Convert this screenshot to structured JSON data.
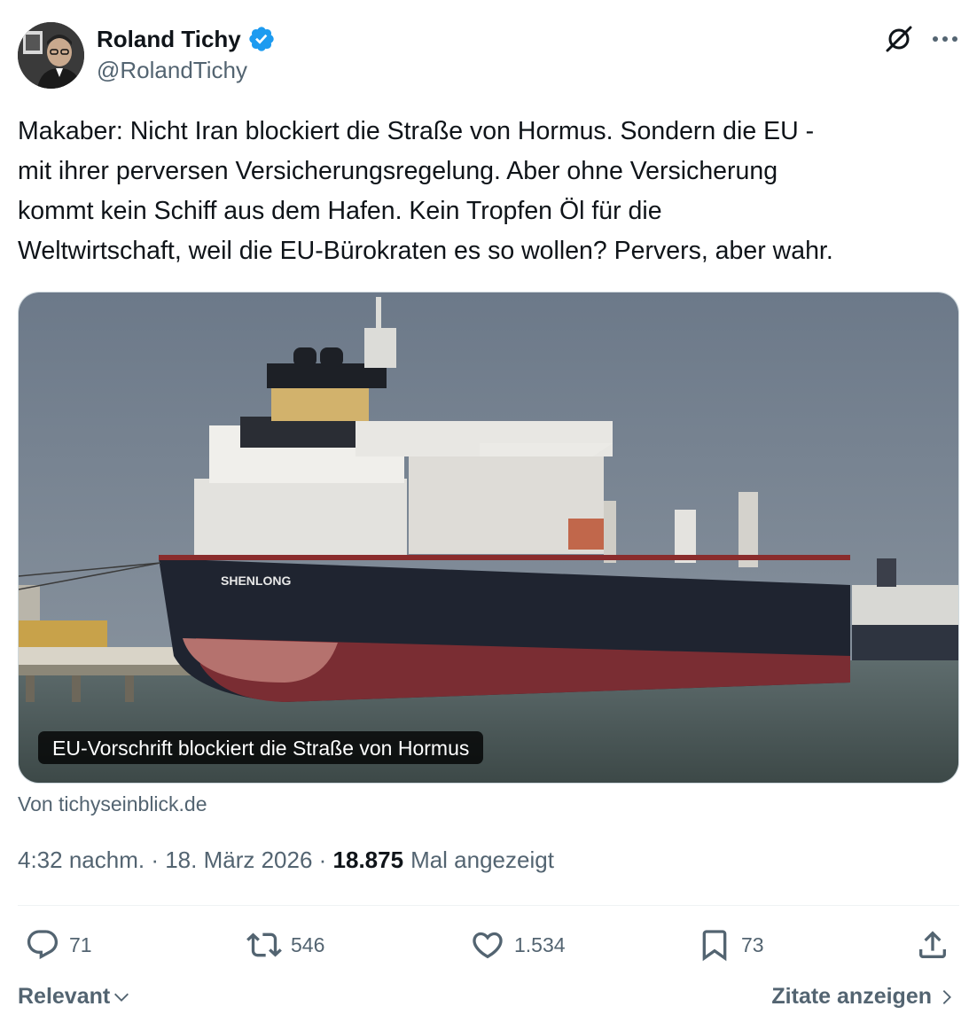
{
  "author": {
    "name": "Roland Tichy",
    "handle": "@RolandTichy",
    "verified": true,
    "verified_color": "#1d9bf0"
  },
  "header_icons": [
    "grok-icon",
    "more-icon"
  ],
  "tweet": {
    "text": "Makaber: Nicht Iran blockiert die Straße von Hormus. Sondern die EU -\nmit ihrer perversen Versicherungsregelung. Aber ohne Versicherung\nkommt kein Schiff aus dem Hafen. Kein Tropfen Öl für die\nWeltwirtschaft, weil die EU-Bürokraten es so wollen? Pervers, aber wahr."
  },
  "card": {
    "image_label": "SHENLONG",
    "caption": "EU-Vorschrift blockiert die Straße von Hormus",
    "source": "Von tichyseinblick.de"
  },
  "meta": {
    "time": "4:32 nachm.",
    "sep1": " · ",
    "date": "18. März 2026",
    "sep2": " · ",
    "views": "18.875",
    "views_label": "Mal angezeigt"
  },
  "actions": {
    "replies": "71",
    "reposts": "546",
    "likes": "1.534",
    "bookmarks": "73"
  },
  "footer": {
    "sort_label": "Relevant",
    "quotes_label": "Zitate anzeigen"
  },
  "colors": {
    "text": "#0f1419",
    "secondary": "#536471",
    "accent": "#1d9bf0"
  }
}
